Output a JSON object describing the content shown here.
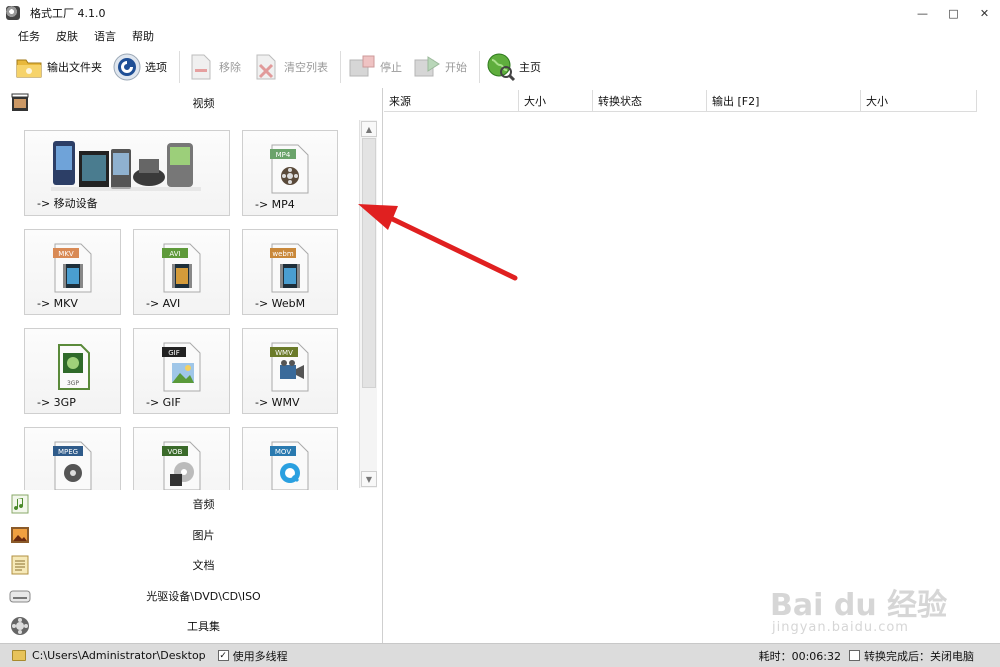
{
  "window": {
    "title": "格式工厂 4.1.0",
    "controls": [
      "—",
      "□",
      "✕"
    ]
  },
  "menu": [
    "任务",
    "皮肤",
    "语言",
    "帮助"
  ],
  "toolbar": {
    "output_folder": "输出文件夹",
    "options": "选项",
    "remove": "移除",
    "clear_list": "清空列表",
    "stop": "停止",
    "start": "开始",
    "home": "主页"
  },
  "categories": {
    "video": "视频",
    "audio": "音频",
    "image": "图片",
    "document": "文档",
    "disc": "光驱设备\\DVD\\CD\\ISO",
    "tools": "工具集"
  },
  "tiles": [
    {
      "label": "-> 移动设备",
      "badge": ""
    },
    {
      "label": "-> MP4",
      "badge": "MP4"
    },
    {
      "label": "-> MKV",
      "badge": "MKV"
    },
    {
      "label": "-> AVI",
      "badge": "AVI"
    },
    {
      "label": "-> WebM",
      "badge": "webm"
    },
    {
      "label": "-> 3GP",
      "badge": "3GP"
    },
    {
      "label": "-> GIF",
      "badge": "GIF"
    },
    {
      "label": "-> WMV",
      "badge": "WMV"
    },
    {
      "label": "",
      "badge": "MPEG"
    },
    {
      "label": "",
      "badge": "VOB"
    },
    {
      "label": "",
      "badge": "MOV"
    }
  ],
  "columns": [
    "来源",
    "大小",
    "转换状态",
    "输出 [F2]",
    "大小"
  ],
  "status": {
    "path": "C:\\Users\\Administrator\\Desktop",
    "multithread": "使用多线程",
    "elapsed": "耗时：00:06:32",
    "after_done": "转换完成后：关闭电脑"
  },
  "watermark": {
    "logo": "Bai du 经验",
    "url": "jingyan.baidu.com"
  },
  "colors": {
    "accent_arrow": "#e02020",
    "tile_border": "#cfcfcf",
    "statusbar": "#dcdcdc"
  }
}
